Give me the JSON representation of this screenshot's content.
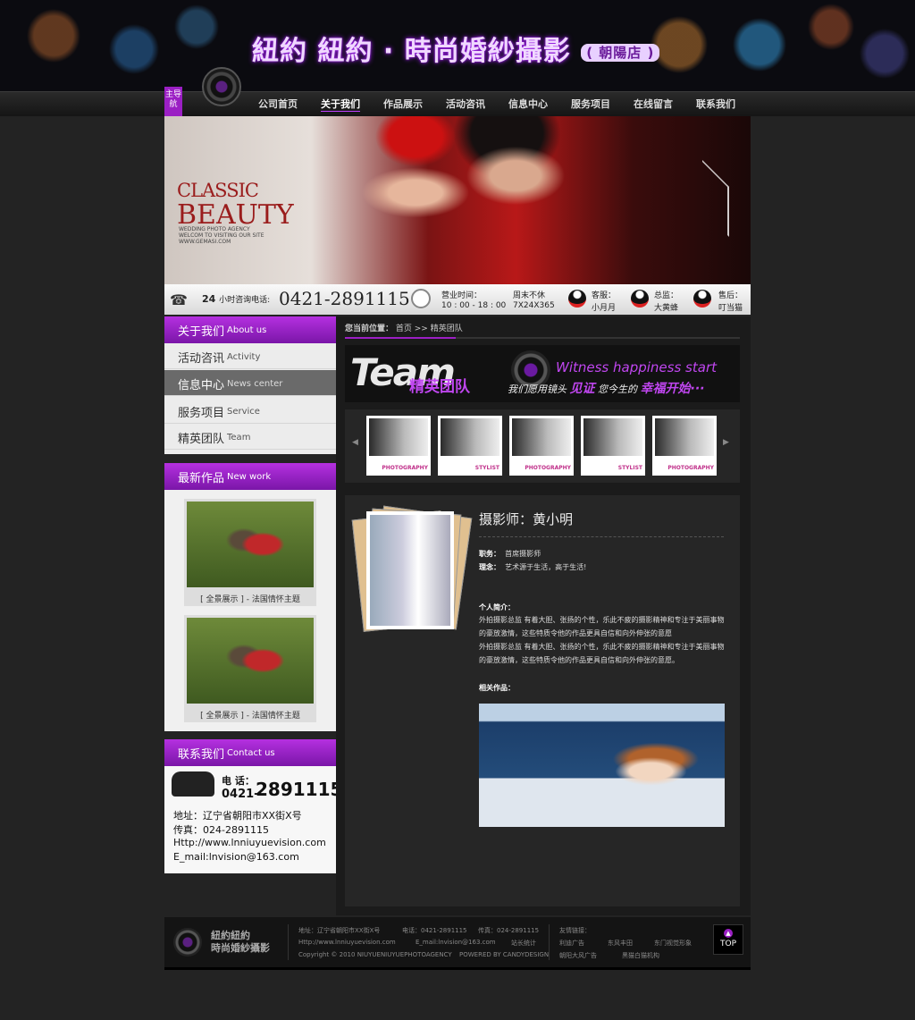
{
  "header": {
    "title": "紐約 紐約 · 時尚婚紗攝影",
    "branch": "( 朝陽店 )",
    "nav_tag": "主导航"
  },
  "nav": {
    "items": [
      {
        "label": "公司首页",
        "active": false
      },
      {
        "label": "关于我们",
        "active": true
      },
      {
        "label": "作品展示",
        "active": false
      },
      {
        "label": "活动咨讯",
        "active": false
      },
      {
        "label": "信息中心",
        "active": false
      },
      {
        "label": "服务项目",
        "active": false
      },
      {
        "label": "在线留言",
        "active": false
      },
      {
        "label": "联系我们",
        "active": false
      }
    ]
  },
  "banner": {
    "headline_1": "CLASSIC",
    "headline_2": "BEAUTY",
    "sub_1": "WEDDING PHOTO AGENCY",
    "sub_2": "WELCOM TO VISITING OUR SITE",
    "sub_3": "WWW.GEMASI.COM"
  },
  "infobar": {
    "hotline_prefix": "24",
    "hotline_label": "小时咨询电话:",
    "hotline_number": "0421-2891115",
    "hours_label": "营业时间：",
    "hours_value": "10 : 00 - 18 : 00",
    "weekend_label": "周末不休",
    "weekend_value": "7X24X365",
    "cs_label": "客服：",
    "cs_name": "小月月",
    "sup_label": "总监：",
    "sup_name": "大黄蜂",
    "as_label": "售后：",
    "as_name": "叮当猫"
  },
  "sidebar": {
    "about_head_cn": "关于我们",
    "about_head_en": "About us",
    "menu": [
      {
        "cn": "活动咨讯",
        "en": "Activity",
        "active": false
      },
      {
        "cn": "信息中心",
        "en": "News center",
        "active": true
      },
      {
        "cn": "服务项目",
        "en": "Service",
        "active": false
      },
      {
        "cn": "精英团队",
        "en": "Team",
        "active": false
      }
    ],
    "new_head_cn": "最新作品",
    "new_head_en": "New work",
    "works": [
      {
        "caption": "[ 全景展示 ] - 法国情怀主题"
      },
      {
        "caption": "[ 全景展示 ] - 法国情怀主题"
      }
    ],
    "contact_head_cn": "联系我们",
    "contact_head_en": "Contact us",
    "contact": {
      "tel_label": "电 话：",
      "tel_area": "0421-",
      "tel_number": "2891115",
      "address": "地址：辽宁省朝阳市XX街X号",
      "fax": "传真：024-2891115",
      "web": "Http://www.lnniuyuevision.com",
      "email": "E_mail:lnvision@163.com"
    }
  },
  "main": {
    "breadcrumb_label": "您当前位置：",
    "breadcrumb_path": "首页 >> 精英团队",
    "team_word": "Team",
    "team_cn": "精英团队",
    "slogan_en": "Witness happiness start",
    "slogan_cn_1": "我们愿用镜头",
    "slogan_cn_hl1": "见证",
    "slogan_cn_2": "您今生的",
    "slogan_cn_hl2": "幸福开始···",
    "thumbs": [
      {
        "label": "PHOTOGRAPHY"
      },
      {
        "label": "STYLIST"
      },
      {
        "label": "PHOTOGRAPHY"
      },
      {
        "label": "STYLIST"
      },
      {
        "label": "PHOTOGRAPHY"
      }
    ],
    "profile": {
      "name": "摄影师：黄小明",
      "role_label": "职务：",
      "role_value": "首席摄影师",
      "motto_label": "理念：",
      "motto_value": "艺术源于生活，高于生活!",
      "intro_label": "个人简介：",
      "intro_1": "外拍摄影总监 有着大胆、张扬的个性，乐此不疲的摄影精神和专注于美丽事物的豪放激情，这些特质令他的作品更具自信和向外伸张的意愿",
      "intro_2": "外拍摄影总监 有着大胆、张扬的个性，乐此不疲的摄影精神和专注于美丽事物的豪放激情，这些特质令他的作品更具自信和向外伸张的意愿。",
      "works_label": "相关作品："
    }
  },
  "footer": {
    "logo_1": "紐約紐約",
    "logo_2": "時尚婚紗攝影",
    "address": "地址：辽宁省朝阳市XX街X号",
    "tel": "电话：0421-2891115",
    "fax": "传真：024-2891115",
    "web": "Http://www.lnniuyuevision.com",
    "email": "E_mail:lnvision@163.com",
    "stats": "站长统计",
    "copyright": "Copyright © 2010 NIUYUENIUYUEPHOTOAGENCY",
    "powered": "POWERED BY CANDYDESIGN",
    "links_label": "友情链接：",
    "links": [
      "利迪广告",
      "东风丰田",
      "东门视觉形象",
      "朝阳大风广告",
      "黑猫白猫机构"
    ],
    "top_label": "TOP"
  },
  "colors": {
    "accent": "#9b1fc4",
    "accent_light": "#c046f0",
    "bg": "#232323"
  }
}
